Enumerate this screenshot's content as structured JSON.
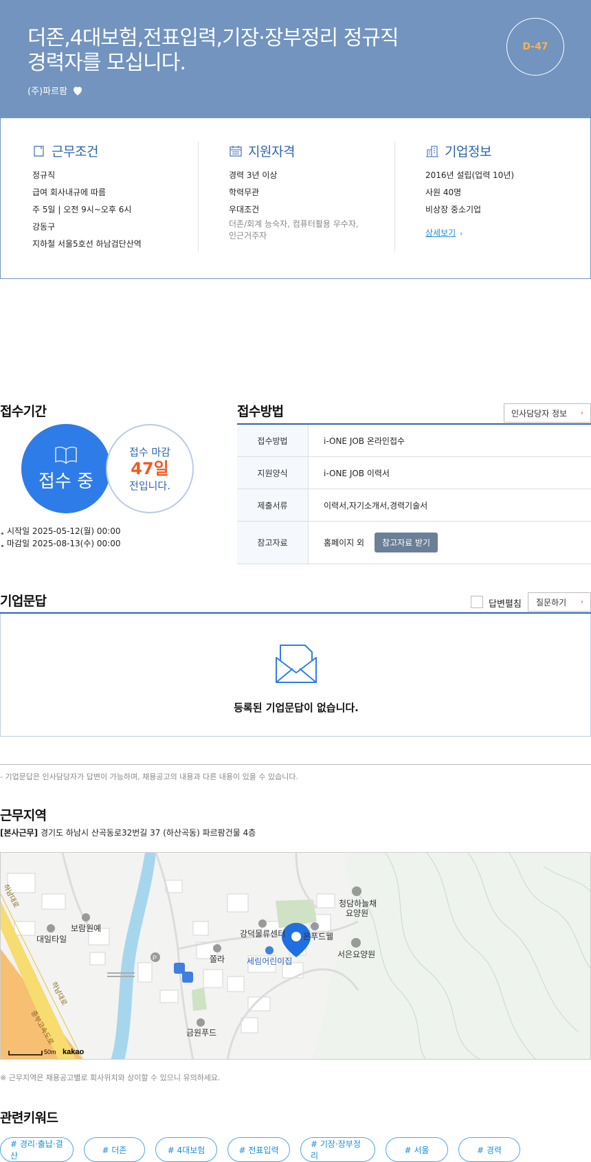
{
  "header": {
    "title_line1": "더존,4대보험,전표입력,기장·장부정리 정규직",
    "title_line2": "경력자를 모십니다.",
    "company": "(주)파르팜",
    "dday": "D-47"
  },
  "summary": {
    "work": {
      "title": "근무조건",
      "items": [
        "정규직",
        "급여 회사내규에 따름",
        "주 5일 | 오전 9시~오후 6시",
        "강동구",
        "지하철 서울5호선 하남검단산역"
      ]
    },
    "qual": {
      "title": "지원자격",
      "items": [
        "경력 3년 이상",
        "학력무관",
        "우대조건"
      ],
      "pref_line1": "더존/회계 능숙자, 컴퓨터활용 우수자,",
      "pref_line2": "인근거주자"
    },
    "company": {
      "title": "기업정보",
      "items": [
        "2016년 설립(업력 10년)",
        "사원 40명",
        "비상장 중소기업"
      ],
      "detail_link": "상세보기"
    }
  },
  "apply_period": {
    "title": "접수기간",
    "status": "접수 중",
    "deadline_label": "접수 마감",
    "deadline_days": "47일",
    "deadline_suffix": "전입니다.",
    "start": "시작일 2025-05-12(월) 00:00",
    "end": "마감일 2025-08-13(수) 00:00"
  },
  "apply_method": {
    "title": "접수방법",
    "hr_button": "인사담당자 정보",
    "rows": [
      {
        "key": "접수방법",
        "value": "i-ONE JOB 온라인접수"
      },
      {
        "key": "지원양식",
        "value": "i-ONE JOB 이력서"
      },
      {
        "key": "제출서류",
        "value": "이력서,자기소개서,경력기술서"
      },
      {
        "key": "참고자료",
        "value": "홈페이지 외",
        "button": "참고자료 받기"
      }
    ]
  },
  "qna": {
    "title": "기업문답",
    "expand_label": "답변펼침",
    "ask_button": "질문하기",
    "empty": "등록된 기업문답이 없습니다.",
    "note": "- 기업문답은 인사담당자가 답변이 가능하며, 채용공고의 내용과 다른 내용이 있을 수 있습니다."
  },
  "location": {
    "title": "근무지역",
    "tag": "[본사근무]",
    "address": "경기도 하남시 산곡동로32번길 37 (하산곡동) 파르팜건물 4층",
    "note": "※ 근무지역은 채용공고별로 회사위치와 상이할 수 있으니 유의하세요.",
    "map_labels": {
      "daeil": "대일타일",
      "boram": "보람원예",
      "gangdeok": "강덕물류센터",
      "onfood": "온푸드웰",
      "cheongdam1": "청담하늘채",
      "cheongdam2": "요양원",
      "seoeun": "서은요양원",
      "jolla": "쫄라",
      "serim": "세림어린이집",
      "geumwon": "금원푸드",
      "road1": "하남대로",
      "road2": "하남대로",
      "highway": "중부고속도로",
      "scale": "50m",
      "kakao": "kakao"
    }
  },
  "keywords": {
    "title": "관련키워드",
    "items": [
      "# 경리·출납·결산",
      "# 더존",
      "# 4대보험",
      "# 전표입력",
      "# 기장·장부정리",
      "# 서울",
      "# 경력"
    ]
  },
  "colors": {
    "header_bg": "#7294bf",
    "primary": "#2d64b0",
    "status_blue": "#2e7ce8",
    "accent_orange": "#f05a22",
    "dday_color": "#ffb24a"
  }
}
